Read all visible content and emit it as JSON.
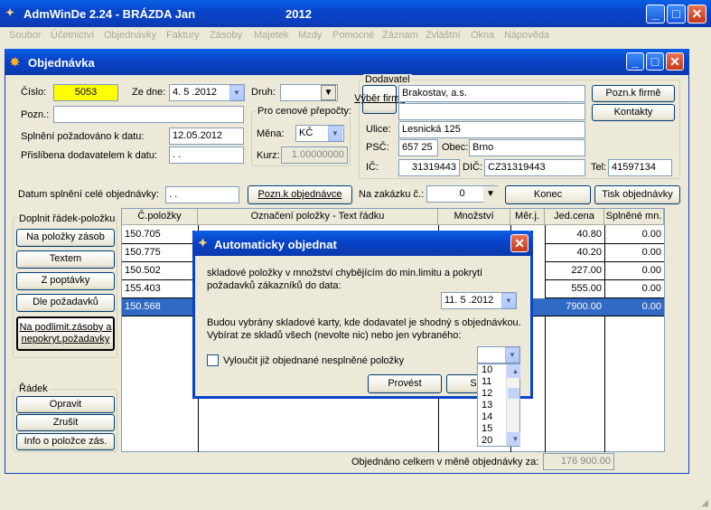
{
  "app": {
    "title": "AdmWinDe 2.24 - BRÁZDA Jan",
    "year": "2012"
  },
  "menu": [
    "Soubor",
    "Účetnictví",
    "Objednávky",
    "Faktury",
    "Zásoby",
    "Majetek",
    "Mzdy",
    "Pomocné",
    "Záznam",
    "Zvláštní",
    "Okna",
    "Nápověda"
  ],
  "window": {
    "title": "Objednávka"
  },
  "form": {
    "cislo_label": "Číslo:",
    "cislo_value": "5053",
    "ze_dne_label": "Ze dne:",
    "ze_dne_value": "4. 5 .2012",
    "druh_label": "Druh:",
    "druh_value": "",
    "pozn_label": "Pozn.:",
    "pozn_value": "",
    "splneni_label": "Splnění požadováno k datu:",
    "splneni_value": "12.05.2012",
    "prislibena_label": "Přislíbena dodavatelem k datu:",
    "prislibena_value": ". .",
    "prepocty_title": "Pro cenové přepočty:",
    "mena_label": "Měna:",
    "mena_value": "KČ",
    "kurz_label": "Kurz:",
    "kurz_value": "1.00000000",
    "datum_splneni_label": "Datum splnění celé objednávky:",
    "datum_splneni_value": ". .",
    "pozn_obj_button": "Pozn.k objednávce",
    "zakazka_label": "Na zakázku č.:",
    "zakazka_value": "0",
    "konec_button": "Konec",
    "tisk_button": "Tisk objednávky"
  },
  "dodavatel": {
    "title": "Dodavatel",
    "vyber_button": "Výběr firmy",
    "name": "Brakostav, a.s.",
    "name2": "",
    "ulice_label": "Ulice:",
    "ulice_value": "Lesnická 125",
    "psc_label": "PSČ:",
    "psc_value": "657 25",
    "obec_label": "Obec:",
    "obec_value": "Brno",
    "ic_label": "IČ:",
    "ic_value": "31319443",
    "dic_label": "DIČ:",
    "dic_value": "CZ31319443",
    "tel_label": "Tel:",
    "tel_value": "41597134",
    "pozn_firme_button": "Pozn.k firmě",
    "kontakty_button": "Kontakty"
  },
  "left_panel": {
    "doplnit_title": "Doplnit řádek-položku",
    "buttons": [
      "Na položky zásob",
      "Textem",
      "Z poptávky",
      "Dle požadavků",
      "Na podlimit.zásoby a nepokryt.požadavky"
    ],
    "radek_title": "Řádek",
    "radek_buttons": [
      "Opravit",
      "Zrušit",
      "Info o položce zás."
    ]
  },
  "table": {
    "headers": [
      "Č.položky",
      "Označení položky - Text řádku",
      "Množství",
      "Měr.j.",
      "Jed.cena",
      "Splněné mn."
    ],
    "rows": [
      {
        "cislo": "150.705",
        "cena": "40.80",
        "splneno": "0.00"
      },
      {
        "cislo": "150.775",
        "cena": "40.20",
        "splneno": "0.00"
      },
      {
        "cislo": "150.502",
        "cena": "227.00",
        "splneno": "0.00"
      },
      {
        "cislo": "155.403",
        "cena": "555.00",
        "splneno": "0.00"
      },
      {
        "cislo": "150.568",
        "cena": "7900.00",
        "splneno": "0.00"
      }
    ],
    "total_label": "Objednáno celkem v měně objednávky za:",
    "total_value": "176 900.00"
  },
  "dialog": {
    "title": "Automaticky objednat",
    "text1": "skladové položky v množství chybějícím do min.limitu a pokrytí požadavků zákazníků do data:",
    "date_value": "11. 5 .2012",
    "text2": "Budou vybrány skladové karty, kde dodavatel je shodný s objednávkou. Vybírat ze skladů všech (nevolte nic) nebo jen vybraného:",
    "checkbox_label": "Vyloučit již objednané nesplněné položky",
    "provest_button": "Provést",
    "storno_button": "S",
    "sklad_list": [
      "10",
      "11",
      "12",
      "13",
      "14",
      "15",
      "20"
    ]
  },
  "colors": {
    "highlight": "#316ac5",
    "yellow": "#ffff00",
    "titlebar": "#0843c8"
  }
}
